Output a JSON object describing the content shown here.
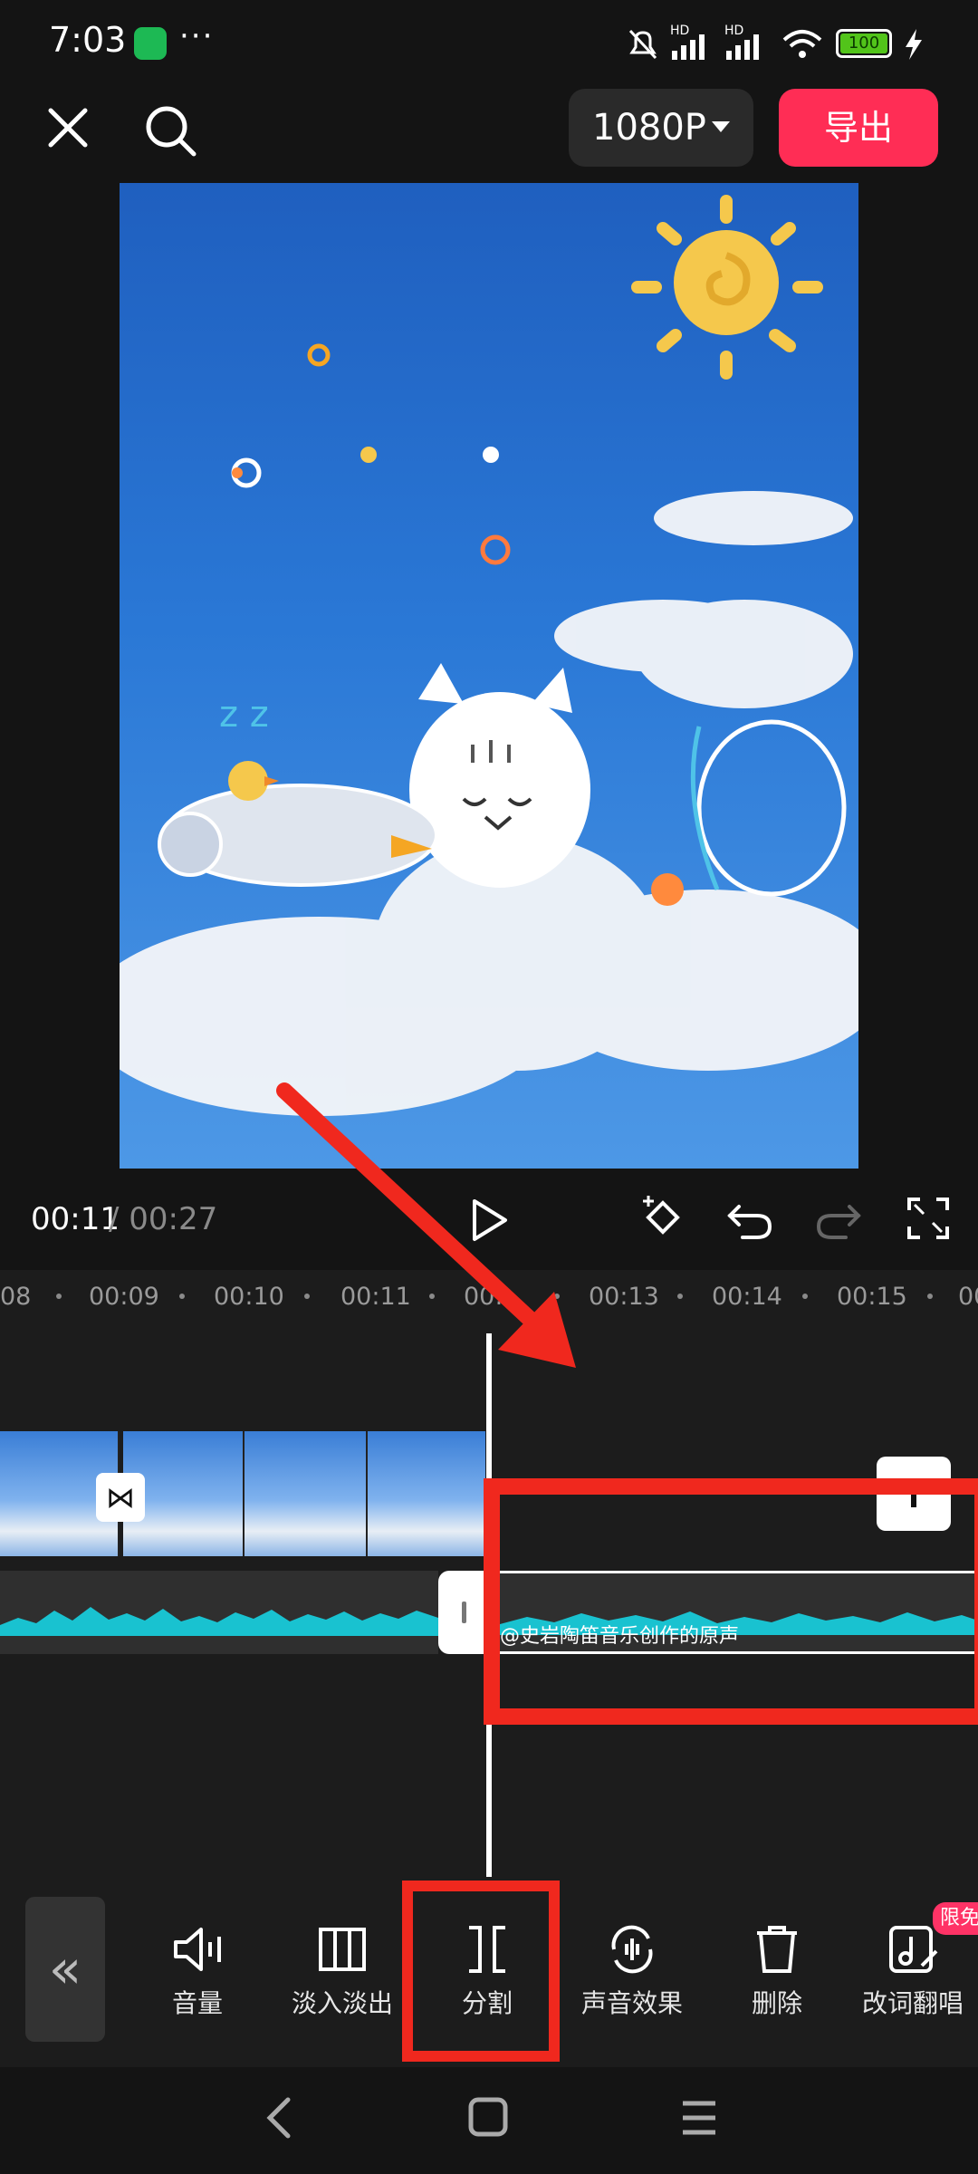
{
  "status_bar": {
    "time": "7:03",
    "more": "···",
    "battery": "100",
    "signal_label": "HD"
  },
  "top_bar": {
    "quality": "1080P",
    "export": "导出"
  },
  "player": {
    "current_time": "00:11",
    "total_time": "/ 00:27"
  },
  "ruler": {
    "ticks": [
      "08",
      "00:09",
      "00:10",
      "00:11",
      "00:",
      "00:13",
      "00:14",
      "00:15",
      "00"
    ]
  },
  "timeline": {
    "transition_icon": "⋈",
    "audio_label": "@史岩陶笛音乐创作的原声"
  },
  "toolbar": {
    "collapse": "«",
    "items": [
      {
        "label": "音量",
        "icon": "speaker-icon"
      },
      {
        "label": "淡入淡出",
        "icon": "fade-icon"
      },
      {
        "label": "分割",
        "icon": "split-icon"
      },
      {
        "label": "声音效果",
        "icon": "voice-effect-icon"
      },
      {
        "label": "删除",
        "icon": "trash-icon"
      },
      {
        "label": "改词翻唱",
        "icon": "music-note-edit-icon"
      }
    ],
    "badge": "限免"
  },
  "colors": {
    "accent": "#ff2d55",
    "highlight": "#f0281e",
    "waveform": "#19c2d0"
  }
}
